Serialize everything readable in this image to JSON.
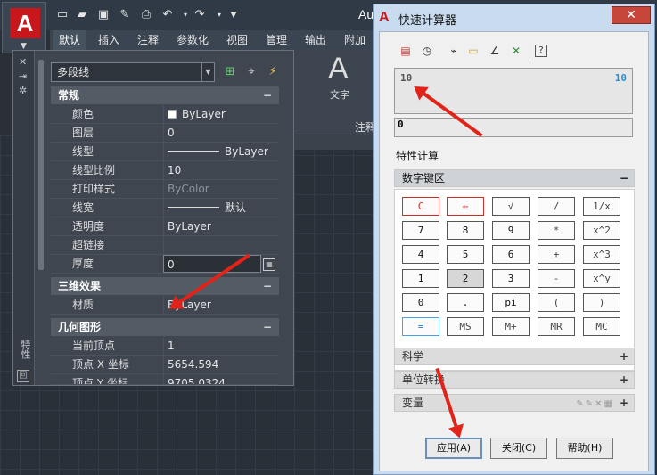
{
  "app": {
    "title": "Au",
    "logo_letter": "A",
    "quick_access_icons": [
      "new-icon",
      "open-icon",
      "save-icon",
      "saveas-icon",
      "plot-icon",
      "undo-icon",
      "redo-icon",
      "dropdown-icon"
    ]
  },
  "ribbon": {
    "tabs": [
      "默认",
      "插入",
      "注释",
      "参数化",
      "视图",
      "管理",
      "输出",
      "附加"
    ],
    "active_tab": "默认",
    "panel": {
      "big_letter": "A",
      "text_label": "文字",
      "group_label": "注释"
    }
  },
  "properties": {
    "object_type": "多段线",
    "strip_label": "特性",
    "sections": {
      "general": {
        "title": "常规",
        "toggle": "−",
        "rows": [
          {
            "key": "颜色",
            "value": "ByLayer"
          },
          {
            "key": "图层",
            "value": "0"
          },
          {
            "key": "线型",
            "value": "ByLayer"
          },
          {
            "key": "线型比例",
            "value": "10"
          },
          {
            "key": "打印样式",
            "value": "ByColor"
          },
          {
            "key": "线宽",
            "value": "默认"
          },
          {
            "key": "透明度",
            "value": "ByLayer"
          },
          {
            "key": "超链接",
            "value": ""
          },
          {
            "key": "厚度",
            "value": "0"
          }
        ]
      },
      "3d": {
        "title": "三维效果",
        "toggle": "−",
        "rows": [
          {
            "key": "材质",
            "value": "ByLayer"
          }
        ]
      },
      "geometry": {
        "title": "几何图形",
        "toggle": "−",
        "rows": [
          {
            "key": "当前顶点",
            "value": "1"
          },
          {
            "key": "顶点 X 坐标",
            "value": "5654.594"
          },
          {
            "key": "顶点 Y 坐标",
            "value": "9705.0324"
          }
        ]
      }
    }
  },
  "quickcalc": {
    "title": "快速计算器",
    "close_label": "✕",
    "toolbar_icons": [
      "clear-icon",
      "clear-history-icon",
      "get-coordinates-icon",
      "distance-icon",
      "angle-icon",
      "intersection-icon",
      "help-icon"
    ],
    "history": {
      "expression": "10",
      "result": "10"
    },
    "input_value": "0",
    "property_label": "特性计算",
    "numpad": {
      "title": "数字键区",
      "toggle": "−",
      "rows": [
        [
          "C",
          "←",
          "√",
          "/",
          "1/x"
        ],
        [
          "7",
          "8",
          "9",
          "*",
          "x^2"
        ],
        [
          "4",
          "5",
          "6",
          "+",
          "x^3"
        ],
        [
          "1",
          "2",
          "3",
          "-",
          "x^y"
        ],
        [
          "0",
          ".",
          "pi",
          "(",
          ")"
        ],
        [
          "=",
          "MS",
          "M+",
          "MR",
          "MC"
        ]
      ]
    },
    "science": {
      "title": "科学",
      "toggle": "+"
    },
    "units": {
      "title": "单位转换",
      "toggle": "+"
    },
    "variables": {
      "title": "变量",
      "toggle": "+"
    },
    "buttons": {
      "apply": "应用(A)",
      "close": "关闭(C)",
      "help": "帮助(H)"
    }
  },
  "colors": {
    "accent_red": "#e2231a",
    "autocad_red": "#c8161d",
    "history_result": "#2b8fd8"
  }
}
